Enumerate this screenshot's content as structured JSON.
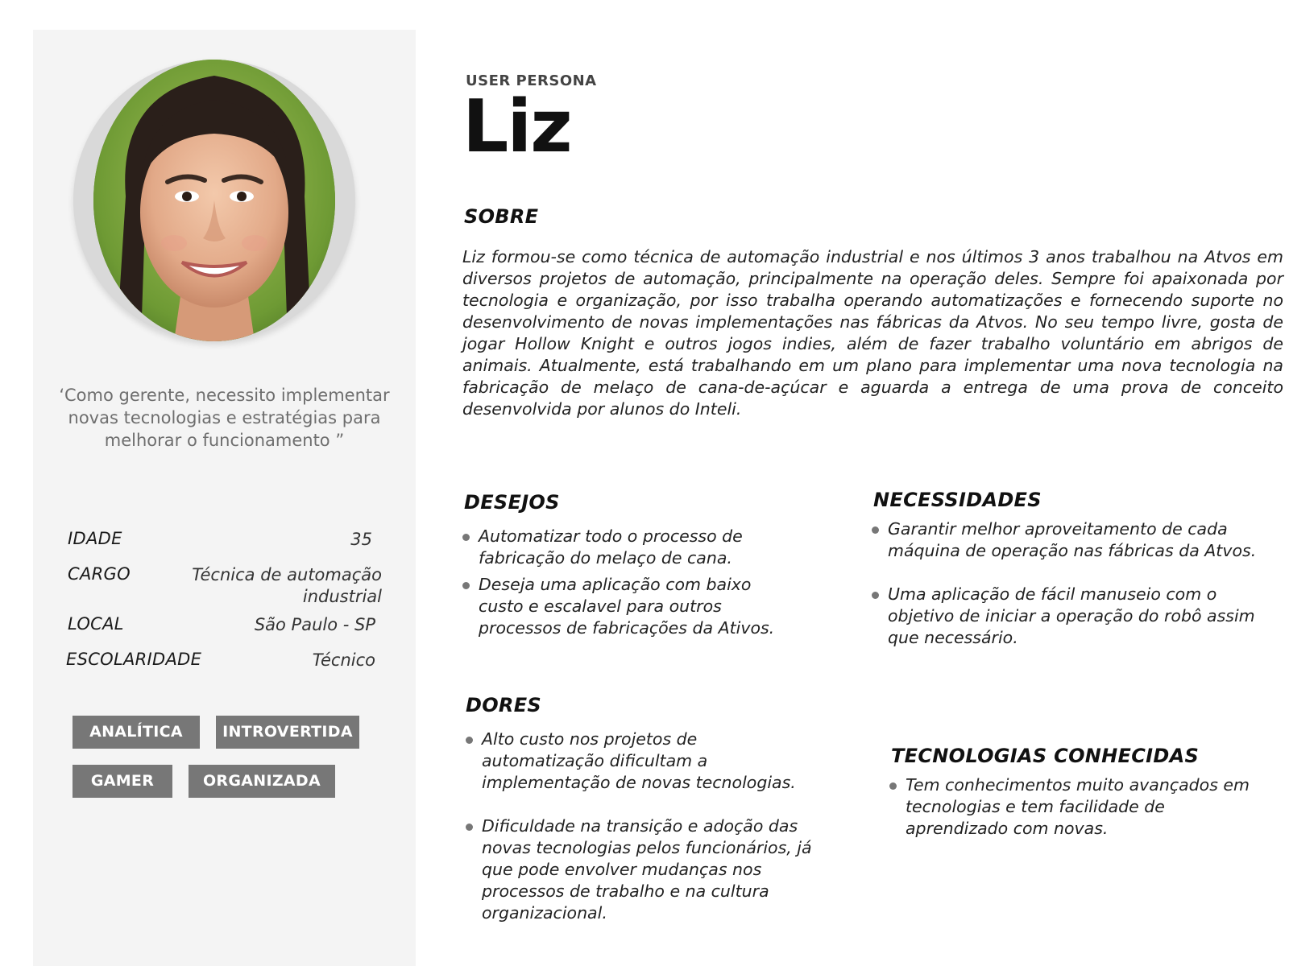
{
  "header": {
    "label": "USER PERSONA",
    "name": "Liz"
  },
  "profile": {
    "quote": "‘Como gerente, necessito implementar novas tecnologias e estratégias para melhorar o funcionamento ”",
    "details": [
      {
        "key": "IDADE",
        "value": "35"
      },
      {
        "key": "CARGO",
        "value": "Técnica de automação industrial"
      },
      {
        "key": "LOCAL",
        "value": "São Paulo - SP"
      },
      {
        "key": "ESCOLARIDADE",
        "value": "Técnico"
      }
    ],
    "tags": [
      "ANALÍTICA",
      "INTROVERTIDA",
      "GAMER",
      "ORGANIZADA"
    ]
  },
  "sobre": {
    "title": "SOBRE",
    "text": "Liz formou-se como técnica de automação industrial e nos últimos 3 anos trabalhou na Atvos em diversos projetos de automação, principalmente na operação deles. Sempre foi apaixonada por tecnologia e organização, por isso trabalha operando automatizações e fornecendo suporte no desenvolvimento de novas implementações nas fábricas da Atvos. No seu tempo livre, gosta de jogar Hollow Knight e outros jogos indies, além de fazer trabalho voluntário em abrigos de animais. Atualmente, está trabalhando em um plano para implementar uma nova tecnologia na fabricação de melaço de cana-de-açúcar e aguarda a entrega de uma prova de conceito desenvolvida por alunos do Inteli."
  },
  "desejos": {
    "title": "DESEJOS",
    "items": [
      "Automatizar todo o processo de fabricação do melaço de cana.",
      "Deseja uma aplicação com baixo custo e escalavel para outros processos de fabricações da Ativos."
    ]
  },
  "necessidades": {
    "title": "NECESSIDADES",
    "items": [
      "Garantir melhor aproveitamento de cada máquina de operação nas fábricas da Atvos.",
      "Uma aplicação de fácil manuseio com o objetivo de iniciar a operação do robô assim que necessário."
    ]
  },
  "dores": {
    "title": "DORES",
    "items": [
      "Alto custo nos projetos de automatização dificultam a implementação de novas tecnologias.",
      "Dificuldade na transição e adoção das novas tecnologias pelos funcionários, já que pode envolver mudanças nos processos de trabalho e na cultura organizacional."
    ]
  },
  "tecnologias": {
    "title": "TECNOLOGIAS CONHECIDAS",
    "items": [
      "Tem conhecimentos muito avançados em tecnologias e tem facilidade de aprendizado com novas."
    ]
  },
  "colors": {
    "panel_bg": "#f4f4f4",
    "tag_bg": "#777777",
    "quote_text": "#6e6e6e"
  }
}
